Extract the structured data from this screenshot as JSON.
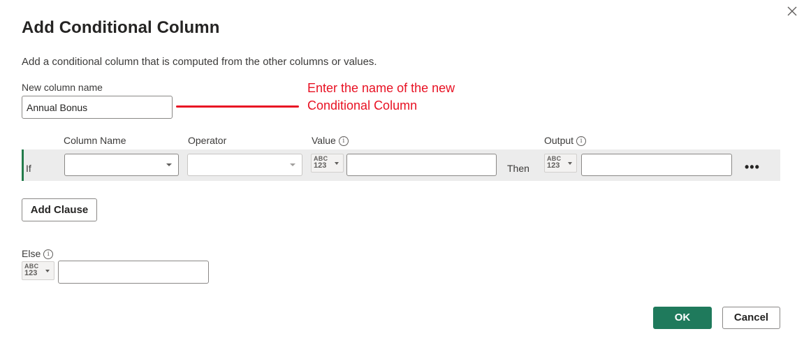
{
  "dialog": {
    "title": "Add Conditional Column",
    "description": "Add a conditional column that is computed from the other columns or values."
  },
  "new_column": {
    "label": "New column name",
    "value": "Annual Bonus"
  },
  "annotation": {
    "text": "Enter the name of the new Conditional Column",
    "color": "#e81123"
  },
  "headers": {
    "column_name": "Column Name",
    "operator": "Operator",
    "value": "Value",
    "output": "Output"
  },
  "clause": {
    "if_label": "If",
    "then_label": "Then",
    "column_name_value": "",
    "operator_value": "",
    "value_value": "",
    "output_value": "",
    "more_label": "•••"
  },
  "type_selector": {
    "line1": "ABC",
    "line2": "123"
  },
  "info_glyph": "i",
  "add_clause_label": "Add Clause",
  "else": {
    "label": "Else",
    "value": ""
  },
  "footer": {
    "ok_label": "OK",
    "cancel_label": "Cancel"
  },
  "colors": {
    "accent": "#1f7a5c",
    "row_bar": "#237b4b",
    "row_background": "#ececec"
  }
}
